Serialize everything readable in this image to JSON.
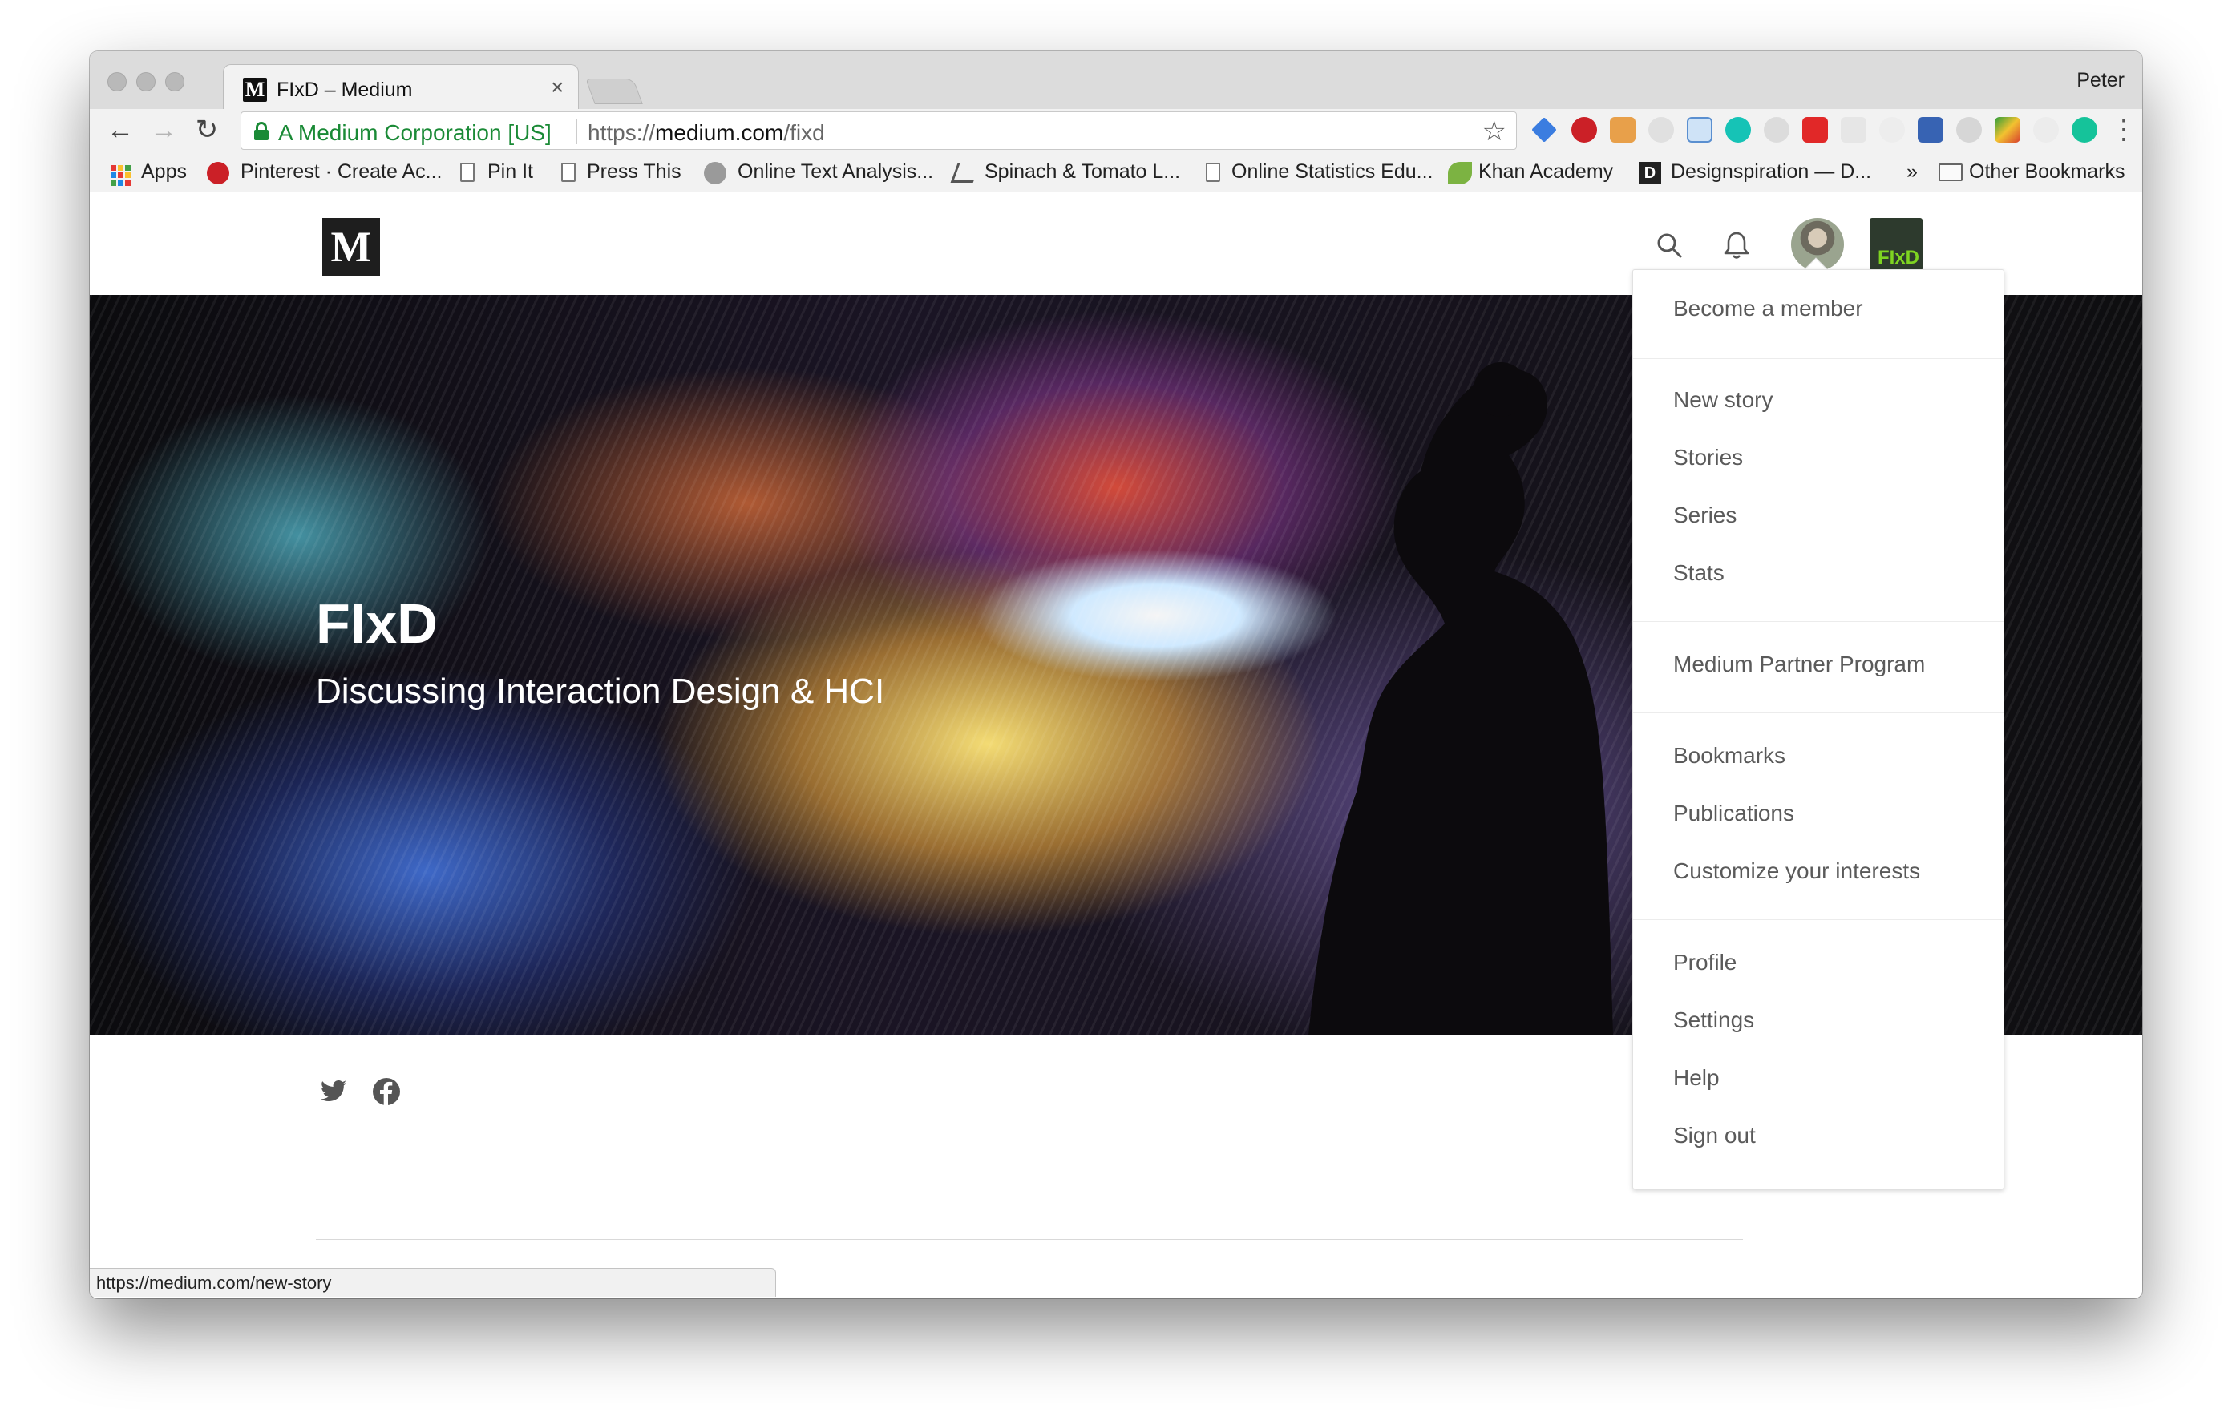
{
  "browser": {
    "tab_title": "FIxD – Medium",
    "tab_favicon_letter": "M",
    "tab_close": "×",
    "profile_name": "Peter",
    "nav": {
      "back": "←",
      "forward": "→",
      "reload": "↻"
    },
    "omnibox": {
      "secure_label": "A Medium Corporation [US]",
      "url_scheme": "https://",
      "url_host": "medium.com",
      "url_path": "/fixd",
      "star": "☆"
    },
    "menu_dots": "⋮",
    "extension_icons": [
      "graduation-icon",
      "pinterest-icon",
      "pin-it-icon",
      "link-icon",
      "doc-icon",
      "mendeley-icon",
      "gear-icon",
      "flipboard-icon",
      "grid-icon",
      "snowflake-icon",
      "zotero-icon",
      "skype-icon",
      "colorful-icon",
      "circle-icon",
      "grammarly-icon",
      "camera-icon"
    ],
    "bookmarks": [
      {
        "label": "Apps",
        "icon": "apps-grid-icon"
      },
      {
        "label": "Pinterest · Create Ac...",
        "icon": "pinterest-icon"
      },
      {
        "label": "Pin It",
        "icon": "doc-icon"
      },
      {
        "label": "Press This",
        "icon": "doc-icon"
      },
      {
        "label": "Online Text Analysis...",
        "icon": "gear-icon"
      },
      {
        "label": "Spinach & Tomato L...",
        "icon": "recipe-icon"
      },
      {
        "label": "Online Statistics Edu...",
        "icon": "doc-icon"
      },
      {
        "label": "Khan Academy",
        "icon": "leaf-icon"
      },
      {
        "label": "Designspiration — D...",
        "icon": "designspiration-icon"
      },
      {
        "label": "»",
        "icon": ""
      },
      {
        "label": "Other Bookmarks",
        "icon": "folder-icon"
      }
    ],
    "status_url": "https://medium.com/new-story"
  },
  "site": {
    "logo_letter": "M",
    "publication_badge": "FIxD",
    "hero": {
      "title": "FIxD",
      "tagline": "Discussing Interaction Design & HCI"
    },
    "dropdown": {
      "items": [
        "Become a member",
        "New story",
        "Stories",
        "Series",
        "Stats",
        "Medium Partner Program",
        "Bookmarks",
        "Publications",
        "Customize your interests",
        "Profile",
        "Settings",
        "Help",
        "Sign out"
      ]
    }
  },
  "colors": {
    "secure_green": "#1a8a36",
    "medium_black": "#1e1e1e",
    "pub_green": "#7ed321",
    "menu_text": "#5a5a5a"
  }
}
